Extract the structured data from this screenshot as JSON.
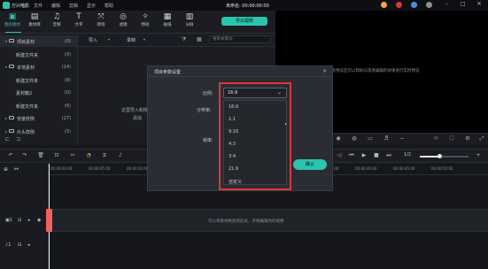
{
  "app": {
    "name": "万兴喵影",
    "doc_title": "未命名: 00:00:00:00",
    "menus": [
      "文件",
      "编辑",
      "剪辑",
      "显示",
      "帮助"
    ]
  },
  "toolbar": {
    "tools": [
      {
        "label": "我的素材",
        "glyph": "▣",
        "icon": "media-icon",
        "active": true
      },
      {
        "label": "素材库",
        "glyph": "▤",
        "icon": "library-icon"
      },
      {
        "label": "音频",
        "glyph": "♫",
        "icon": "music-icon"
      },
      {
        "label": "文字",
        "glyph": "T",
        "icon": "text-icon"
      },
      {
        "label": "转场",
        "glyph": "⤧",
        "icon": "transition-icon"
      },
      {
        "label": "滤镜",
        "glyph": "◎",
        "icon": "filter-icon"
      },
      {
        "label": "特效",
        "glyph": "✧",
        "icon": "effects-icon"
      },
      {
        "label": "贴纸",
        "glyph": "▦",
        "icon": "sticker-icon"
      },
      {
        "label": "分屏",
        "glyph": "▥",
        "icon": "splitscreen-icon"
      }
    ],
    "export_label": "导出视频"
  },
  "sidebar": {
    "items": [
      {
        "label": "项目素材",
        "count": "(0)",
        "caret": "▾"
      },
      {
        "label": "新建文件夹",
        "count": "(0)"
      },
      {
        "label": "本地素材",
        "count": "(14)",
        "caret": "▾"
      },
      {
        "label": "新建文件夹",
        "count": "(8)"
      },
      {
        "label": "素材籍2",
        "count": "(0)"
      },
      {
        "label": "新建文件夹",
        "count": "(6)"
      },
      {
        "label": "背景样例",
        "count": "(27)",
        "caret": "▸"
      },
      {
        "label": "片头样例",
        "count": "(5)",
        "caret": "▸"
      }
    ]
  },
  "media": {
    "import_label": "导入",
    "record_label": "录制",
    "search_placeholder": "搜索关键词",
    "drop_hint_1": "这里导入和拖放",
    "drop_hint_2": "添加"
  },
  "preview": {
    "hint": "在此预览区可以帮助与或者编辑的效果进行实时预览",
    "page": "1/2"
  },
  "timeline": {
    "ticks": [
      "00:00:00:00",
      "00:00:05:00",
      "00:00:10:00",
      "00:00:15:00",
      "00:00:20:00",
      "00:00:25:00",
      "00:00:30:00",
      "00:00:35:00",
      "00:00:40:00",
      "00:00:45:00",
      "00:00:50:00"
    ],
    "track_hint": "可以将素材拖放到此处，开始编辑你的视频",
    "progress": 0.4
  },
  "modal": {
    "title": "项目参数设置",
    "ratio_label": "比例:",
    "resolution_label": "分辨率:",
    "framerate_label": "帧率:",
    "selected": "16:9",
    "options": [
      "16:9",
      "1:1",
      "9:16",
      "4:3",
      "3:4",
      "21:9",
      "自定义"
    ],
    "ok_label": "确认",
    "close": "×"
  },
  "colors": {
    "accent": "#2bc4ad",
    "highlight": "#e0343a",
    "playhead": "#f06060"
  }
}
